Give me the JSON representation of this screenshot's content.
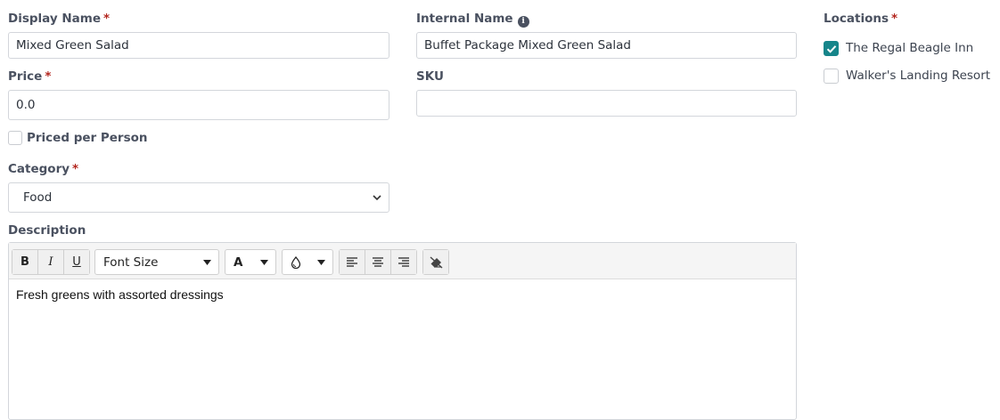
{
  "form": {
    "display_name": {
      "label": "Display Name",
      "required": "*",
      "value": "Mixed Green Salad"
    },
    "internal_name": {
      "label": "Internal Name",
      "info_icon": "info-icon",
      "value": "Buffet Package Mixed Green Salad"
    },
    "price": {
      "label": "Price",
      "required": "*",
      "value": "0.0"
    },
    "sku": {
      "label": "SKU",
      "value": ""
    },
    "priced_per_person": {
      "label": "Priced per Person",
      "checked": false
    },
    "category": {
      "label": "Category",
      "required": "*",
      "selected": "Food"
    },
    "description": {
      "label": "Description",
      "content": "Fresh greens with assorted dressings",
      "toolbar": {
        "bold": "B",
        "italic": "I",
        "underline": "U",
        "font_size": "Font Size",
        "font_color": "A",
        "highlight_icon": "droplet-icon",
        "align_left_icon": "align-left-icon",
        "align_center_icon": "align-center-icon",
        "align_right_icon": "align-right-icon",
        "clear_format_icon": "eraser-icon"
      }
    }
  },
  "locations": {
    "label": "Locations",
    "required": "*",
    "items": [
      {
        "name": "The Regal Beagle Inn",
        "checked": true
      },
      {
        "name": "Walker's Landing Resort",
        "checked": false
      }
    ]
  },
  "colors": {
    "accent": "#16858a",
    "required": "#b3261e"
  }
}
